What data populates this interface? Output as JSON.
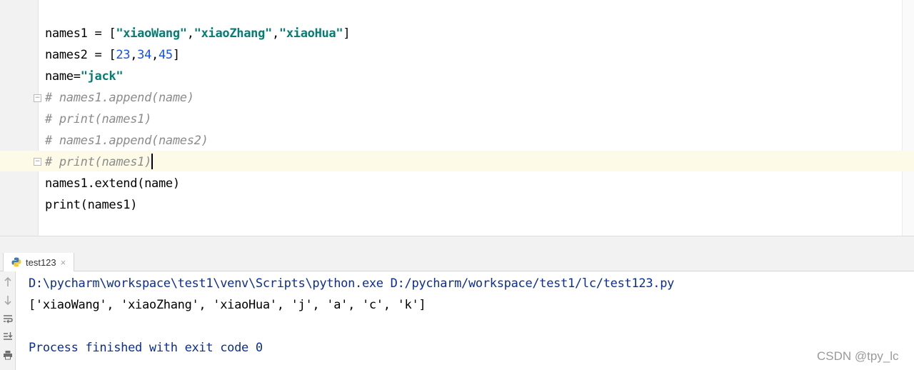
{
  "editor": {
    "lines": {
      "l1": {
        "a": "names1 = [",
        "s1": "\"xiaoWang\"",
        "c1": ",",
        "s2": "\"xiaoZhang\"",
        "c2": ",",
        "s3": "\"xiaoHua\"",
        "b": "]"
      },
      "l2": {
        "a": "names2 = [",
        "n1": "23",
        "c1": ",",
        "n2": "34",
        "c2": ",",
        "n3": "45",
        "b": "]"
      },
      "l3": {
        "a": "name=",
        "s1": "\"jack\""
      },
      "l4": "# names1.append(name)",
      "l5": "# print(names1)",
      "l6": "# names1.append(names2)",
      "l7": "# print(names1)",
      "l8": "names1.extend(name)",
      "l9": "print(names1)"
    }
  },
  "run": {
    "tab_label": "test123",
    "tab_close": "×",
    "console": {
      "cmd": "D:\\pycharm\\workspace\\test1\\venv\\Scripts\\python.exe D:/pycharm/workspace/test1/lc/test123.py",
      "output": "['xiaoWang', 'xiaoZhang', 'xiaoHua', 'j', 'a', 'c', 'k']",
      "exit": "Process finished with exit code 0"
    },
    "toolbar_icons": [
      "arrow-up-icon",
      "arrow-down-icon",
      "soft-wrap-icon",
      "scroll-to-end-icon",
      "print-icon"
    ]
  },
  "watermark": "CSDN @tpy_lc",
  "colors": {
    "string": "#067d73",
    "number": "#1750eb",
    "comment": "#8c8c8c",
    "console_text": "#0b2d99",
    "caret_row": "#fdfbe7"
  }
}
